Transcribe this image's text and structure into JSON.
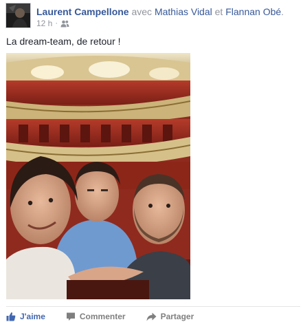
{
  "post": {
    "author": "Laurent Campellone",
    "with_text": "avec",
    "friend1": "Mathias Vidal",
    "and_text": "et",
    "friend2": "Flannan Obé",
    "trailing": ".",
    "time": "12 h",
    "separator": "·",
    "audience_icon": "friends-icon",
    "text": "La dream-team, de retour !"
  },
  "actions": {
    "like": "J'aime",
    "comment": "Commenter",
    "share": "Partager"
  },
  "colors": {
    "link": "#365899",
    "meta": "#90949c",
    "like_blue": "#4267b2",
    "action_grey": "#7f7f7f"
  }
}
